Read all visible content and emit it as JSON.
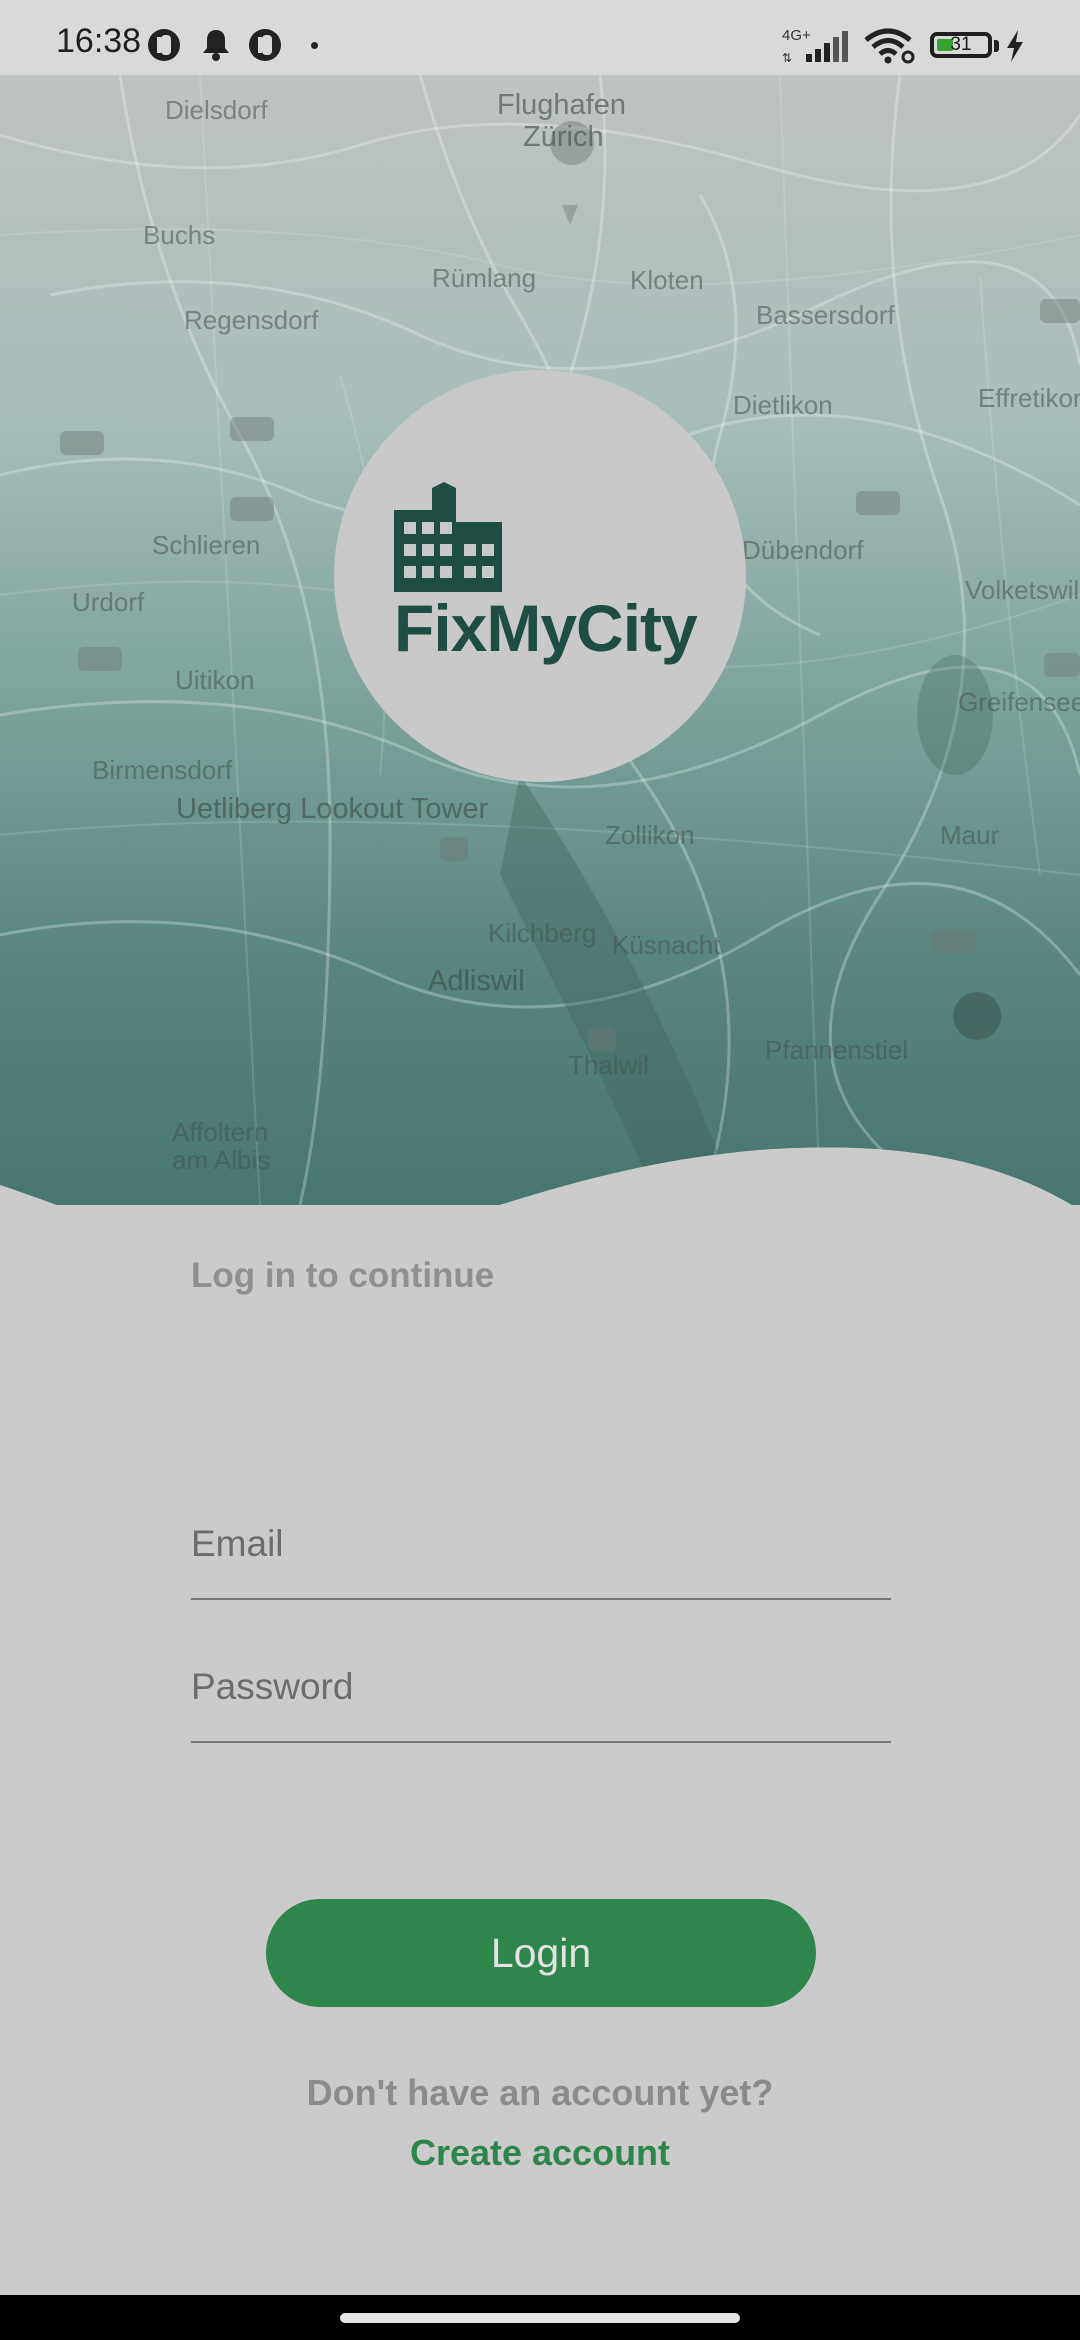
{
  "status_bar": {
    "time": "16:38",
    "network": "4G+",
    "battery_level": "31",
    "icons": [
      "app-notification-icon",
      "bell-icon",
      "app-notification-icon",
      "signal-icon",
      "wifi-icon",
      "battery-icon",
      "charging-icon"
    ]
  },
  "map": {
    "labels": [
      "Dielsdorf",
      "Flughafen",
      "Zürich",
      "Buchs",
      "Rümlang",
      "Kloten",
      "Regensdorf",
      "Bassersdorf",
      "Dietlikon",
      "Effretikon",
      "Schlieren",
      "Dübendorf",
      "Volketswil",
      "Urdorf",
      "Uitikon",
      "Birmensdorf",
      "Uetliberg Lookout Tower",
      "Zollikon",
      "Maur",
      "Kilchberg",
      "Küsnacht",
      "Adliswil",
      "Thalwil",
      "Pfannenstiel",
      "Affoltern am Albis",
      "Greifensee"
    ]
  },
  "app": {
    "logo_text": "FixMyCity"
  },
  "login": {
    "subtitle": "Log in to continue",
    "email_placeholder": "Email",
    "password_placeholder": "Password",
    "button_label": "Login",
    "no_account_text": "Don't have an account yet?",
    "create_account_link": "Create account"
  },
  "colors": {
    "brand_green": "#2e864d",
    "logo_dark_green": "#1e4d44",
    "background": "#cbcbcb"
  }
}
